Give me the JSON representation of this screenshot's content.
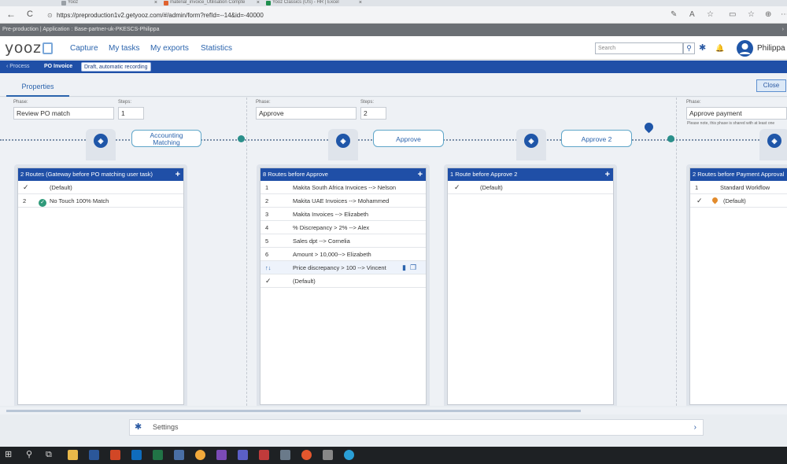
{
  "browser": {
    "tabs": [
      {
        "title": "Yooz",
        "color": "#9aa0a6"
      },
      {
        "title": "material_invoice_Utilisation Compte",
        "color": "#e0622f"
      },
      {
        "title": "Yooz Classics (US) - HR | Excel",
        "color": "#1f8f4e"
      }
    ],
    "url": "https://preproduction1v2.getyooz.com/#/admin/form?refId=--14&id=-40000",
    "nav_icons": {
      "back": "←",
      "refresh": "C",
      "lock": "⊙"
    },
    "action_icons": [
      "✎",
      "A",
      "☆",
      "▭",
      "☆",
      "⊕",
      "⋯"
    ]
  },
  "env_bar": {
    "text": "Pre-production | Application : Base-partner-uk-PKESCS-Philippa",
    "chevron": "›"
  },
  "app": {
    "logo": "yooz",
    "nav": [
      "Capture",
      "My tasks",
      "My exports",
      "Statistics"
    ],
    "search_placeholder": "Search",
    "user": "Philippa",
    "icons": {
      "search": "⚲",
      "gear": "✱",
      "bell": "🔔",
      "user": "●"
    }
  },
  "breadcrumb": {
    "back": "‹ Process",
    "current": "PO Invoice",
    "badge": "Draft, automatic recording"
  },
  "properties_tab": "Properties",
  "close_label": "Close",
  "phases": [
    {
      "phase_label": "Phase:",
      "phase": "Review PO match",
      "steps_label": "Steps:",
      "steps": "1"
    },
    {
      "phase_label": "Phase:",
      "phase": "Approve",
      "steps_label": "Steps:",
      "steps": "2"
    },
    {
      "phase_label": "Phase:",
      "phase": "Approve payment",
      "note": "Please note, this phase is shared with at least one"
    }
  ],
  "tasks": {
    "accounting_line1": "Accounting",
    "accounting_line2": "Matching",
    "approve": "Approve",
    "approve2": "Approve 2"
  },
  "gateway_glyph": "◈",
  "panels": [
    {
      "title": "2 Routes (Gateway before PO matching user task)",
      "rows": [
        {
          "num": "✓",
          "label": "(Default)"
        },
        {
          "num": "2",
          "label": "No Touch 100% Match"
        }
      ]
    },
    {
      "title": "8 Routes before Approve",
      "rows": [
        {
          "num": "1",
          "label": "Makita South Africa Invoices --> Nelson"
        },
        {
          "num": "2",
          "label": "Makita UAE Invoices --> Mohammed"
        },
        {
          "num": "3",
          "label": "Makita Invoices --> Elizabeth"
        },
        {
          "num": "4",
          "label": "% Discrepancy > 2% --> Alex"
        },
        {
          "num": "5",
          "label": "Sales dpt --> Cornelia"
        },
        {
          "num": "6",
          "label": "Amount > 10,000--> Elizabeth"
        },
        {
          "num": "↑↓",
          "label": "Price discrepancy > 100 --> Vincent"
        },
        {
          "num": "✓",
          "label": "(Default)"
        }
      ]
    },
    {
      "title": "1 Route before Approve 2",
      "rows": [
        {
          "num": "✓",
          "label": "(Default)"
        }
      ]
    },
    {
      "title": "2 Routes before Payment Approval",
      "rows": [
        {
          "num": "1",
          "label": "Standard Workflow"
        },
        {
          "num": "✓",
          "label": "(Default)"
        }
      ]
    }
  ],
  "plus": "+",
  "settings_label": "Settings",
  "settings_arrow": "›"
}
